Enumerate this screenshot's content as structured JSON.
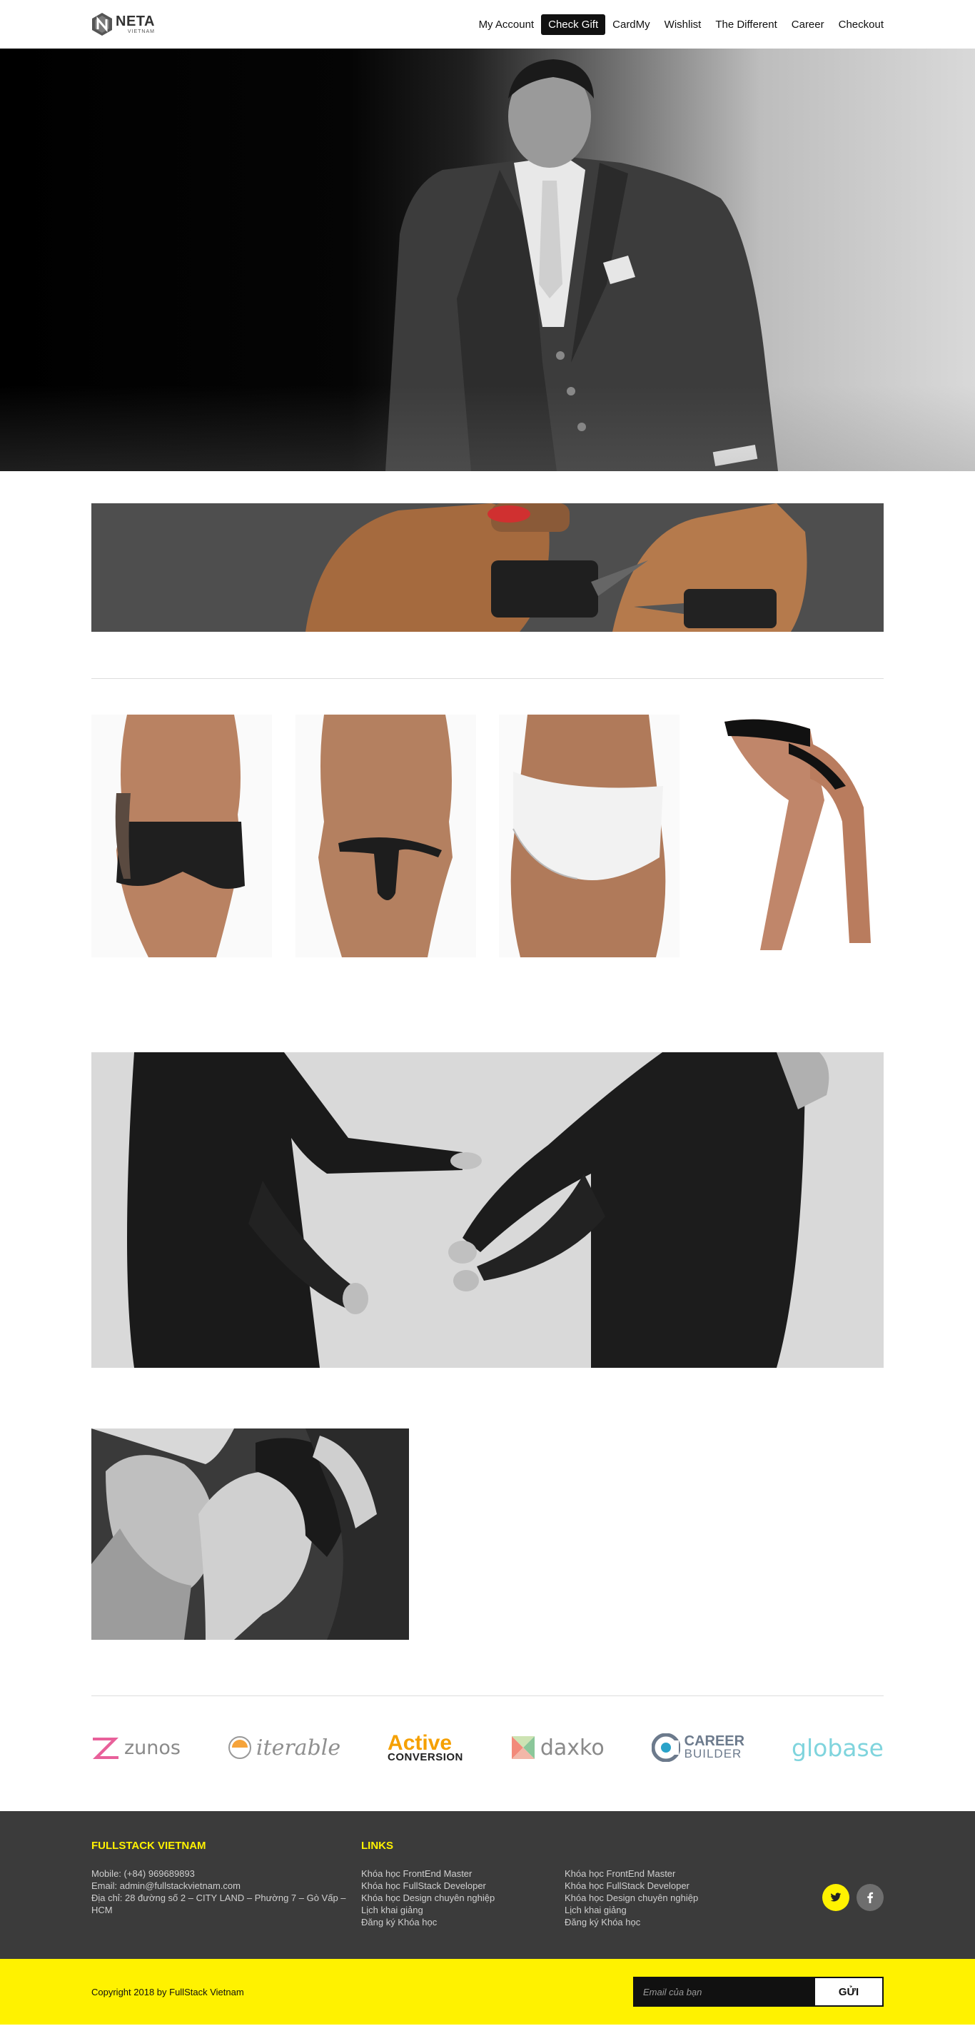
{
  "header": {
    "logo": {
      "name": "NETA",
      "sub": "VIETNAM"
    },
    "nav": [
      {
        "label": "My Account",
        "active": false
      },
      {
        "label": "Check Gift",
        "active": true
      },
      {
        "label": "CardMy",
        "active": false
      },
      {
        "label": "Wishlist",
        "active": false
      },
      {
        "label": "The Different",
        "active": false
      },
      {
        "label": "Career",
        "active": false
      },
      {
        "label": "Checkout",
        "active": false
      }
    ]
  },
  "images": {
    "hero": "man-in-suit-photo",
    "promo": "models-with-drill-photo",
    "products": [
      "leather-boxer-photo",
      "leather-thong-photo",
      "white-brief-photo",
      "black-jockstrap-photo"
    ],
    "banner": "two-men-leather-coats-photo",
    "small": "two-men-embrace-photo"
  },
  "brands": {
    "zunos": "zunos",
    "iterable": "iterable",
    "active_1": "Active",
    "active_2": "CONVERSION",
    "daxko": "daxko",
    "career_1": "CAREER",
    "career_2": "BUILDER",
    "globase": "globase"
  },
  "footer": {
    "col1": {
      "title": "FULLSTACK VIETNAM",
      "mobile": "Mobile: (+84) 969689893",
      "email": "Email: admin@fullstackvietnam.com",
      "address": "Địa chỉ: 28 đường số 2 – CITY LAND – Phường 7 – Gò Vấp – HCM"
    },
    "col2": {
      "title": "LINKS",
      "links": [
        "Khóa học FrontEnd Master",
        "Khóa học FullStack Developer",
        "Khóa học Design chuyên nghiệp",
        "Lịch khai giảng",
        "Đăng ký Khóa học"
      ]
    },
    "col3": {
      "links": [
        "Khóa học FrontEnd Master",
        "Khóa học FullStack Developer",
        "Khóa học Design chuyên nghiệp",
        "Lịch khai giảng",
        "Đăng ký Khóa học"
      ]
    },
    "social": {
      "twitter": "twitter-icon",
      "facebook": "facebook-icon"
    }
  },
  "bottom": {
    "copyright": "Copyright 2018 by FullStack Vietnam",
    "email_placeholder": "Email của bạn",
    "submit_label": "GỬI"
  },
  "colors": {
    "accent": "#fff200",
    "footer_bg": "#3b3b3b",
    "nav_active": "#111111"
  }
}
